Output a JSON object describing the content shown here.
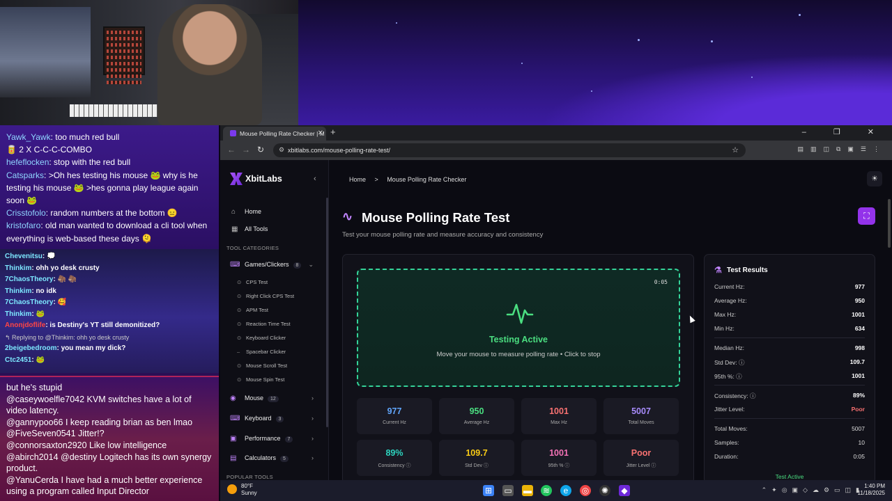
{
  "chat_top": [
    {
      "user": "Yawk_Yawk",
      "text": ": too much red bull"
    },
    {
      "user": "",
      "text": "🥫 2 X C-C-C-COMBO"
    },
    {
      "user": "hefeflocken",
      "text": ": stop with the red bull"
    },
    {
      "user": "Catsparks",
      "text": ": >Oh hes testing his mouse 🐸 why is he testing his mouse 🐸 >hes gonna play league again soon 🐸"
    },
    {
      "user": "Crisstofolo",
      "text": ": random numbers at the bottom 😑"
    },
    {
      "user": "kristofaro",
      "text": ": old man wanted to download a cli tool when everything is web-based these days 🫠"
    }
  ],
  "chat_mid": [
    {
      "user": "Chevenitsu",
      "text": ": 💭",
      "cls": "u"
    },
    {
      "user": "Thinkim",
      "text": ": ohh yo desk crusty",
      "cls": "u"
    },
    {
      "user": "7ChaosTheory",
      "text": ": 🦣 🦣",
      "cls": "u"
    },
    {
      "user": "Thinkim",
      "text": ": no idk",
      "cls": "u"
    },
    {
      "user": "7ChaosTheory",
      "text": ": 🥰",
      "cls": "u"
    },
    {
      "user": "Thinkim",
      "text": ": 🐸",
      "cls": "u"
    },
    {
      "user": "Anonjdoflife",
      "text": ": is Destiny's YT still demonitized?",
      "cls": "r"
    },
    {
      "user": "",
      "text": "↰ Replying to @Thinkim: ohh yo desk crusty",
      "cls": "rep"
    },
    {
      "user": "2beigebedroom",
      "text": ": you mean my dick?",
      "cls": "u"
    },
    {
      "user": "Ctc2451",
      "text": ": 🐸",
      "cls": "u"
    }
  ],
  "chat_bottom": [
    "but he's stupid",
    "@caseywoelfle7042 KVM switches have a lot of video latency.",
    "@gannypoo66 I keep reading brian as ben lmao",
    "@FiveSeven0541 Jitter!?",
    "@connorsaxton2920 Like low intelligence",
    "@abirch2014 @destiny Logitech has its own synergy product.",
    "@YanuCerda I have had a much better experience using a program called Input Director"
  ],
  "browser": {
    "tab_title": "Mouse Polling Rate Checker | M",
    "url": "xbitlabs.com/mouse-polling-rate-test/",
    "new_tab": "+",
    "window_controls": "– ❐ ✕"
  },
  "sidebar": {
    "logo": "XbitLabs",
    "home": "Home",
    "all_tools": "All Tools",
    "tool_categories": "TOOL CATEGORIES",
    "popular_tools": "POPULAR TOOLS",
    "groups": [
      {
        "label": "Games/Clickers",
        "count": "8"
      },
      {
        "label": "Mouse",
        "count": "12"
      },
      {
        "label": "Keyboard",
        "count": "3"
      },
      {
        "label": "Performance",
        "count": "7"
      },
      {
        "label": "Calculators",
        "count": "5"
      }
    ],
    "subitems": [
      "CPS Test",
      "Right Click CPS Test",
      "APM Test",
      "Reaction Time Test",
      "Keyboard Clicker",
      "Spacebar Clicker",
      "Mouse Scroll Test",
      "Mouse Spin Test"
    ]
  },
  "breadcrumb": {
    "home": "Home",
    "sep": ">",
    "current": "Mouse Polling Rate Checker"
  },
  "page": {
    "title": "Mouse Polling Rate Test",
    "subtitle": "Test your mouse polling rate and measure accuracy and consistency"
  },
  "test": {
    "timer": "0:05",
    "status": "Testing Active",
    "hint": "Move your mouse to measure polling rate • Click to stop"
  },
  "stats": [
    {
      "value": "977",
      "label": "Current Hz",
      "color": "#60a5fa"
    },
    {
      "value": "950",
      "label": "Average Hz",
      "color": "#4ade80"
    },
    {
      "value": "1001",
      "label": "Max Hz",
      "color": "#f87171"
    },
    {
      "value": "5007",
      "label": "Total Moves",
      "color": "#a78bfa"
    },
    {
      "value": "89%",
      "label": "Consistency ⓘ",
      "color": "#2dd4bf"
    },
    {
      "value": "109.7",
      "label": "Std Dev ⓘ",
      "color": "#facc15"
    },
    {
      "value": "1001",
      "label": "95th % ⓘ",
      "color": "#f472b6"
    },
    {
      "value": "Poor",
      "label": "Jitter Level ⓘ",
      "color": "#f87171"
    }
  ],
  "results": {
    "title": "Test Results",
    "rows": [
      {
        "label": "Current Hz:",
        "value": "977"
      },
      {
        "label": "Average Hz:",
        "value": "950"
      },
      {
        "label": "Max Hz:",
        "value": "1001"
      },
      {
        "label": "Min Hz:",
        "value": "634"
      },
      {
        "label": "Median Hz:",
        "value": "998"
      },
      {
        "label": "Std Dev: ⓘ",
        "value": "109.7"
      },
      {
        "label": "95th %: ⓘ",
        "value": "1001"
      },
      {
        "label": "Consistency: ⓘ",
        "value": "89%"
      },
      {
        "label": "Jitter Level:",
        "value": "Poor"
      },
      {
        "label": "Total Moves:",
        "value": "5007"
      },
      {
        "label": "Samples:",
        "value": "10"
      },
      {
        "label": "Duration:",
        "value": "0:05"
      }
    ],
    "status": "Test Active"
  },
  "taskbar": {
    "temp": "80°F",
    "condition": "Sunny",
    "time": "1:40 PM",
    "date": "11/18/2025"
  }
}
